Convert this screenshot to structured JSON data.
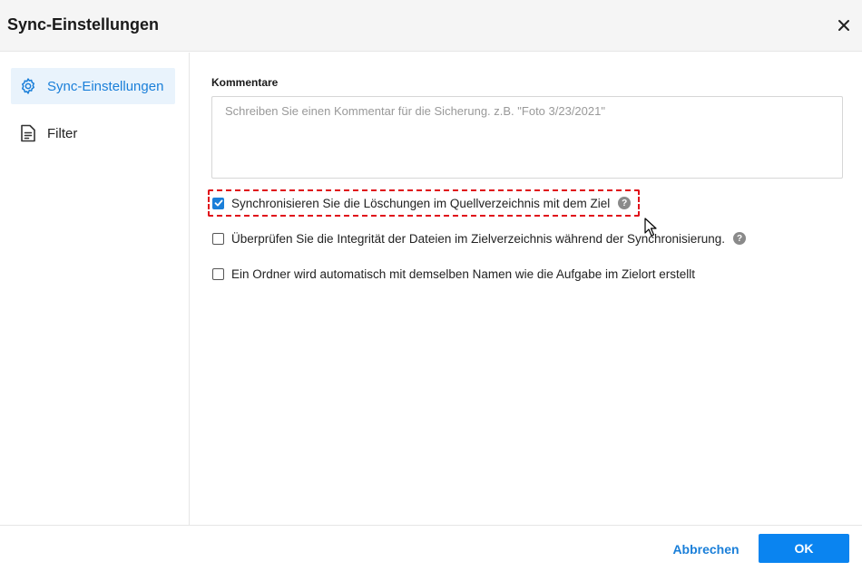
{
  "dialog": {
    "title": "Sync-Einstellungen",
    "close_icon": "close-icon"
  },
  "sidebar": {
    "items": [
      {
        "label": "Sync-Einstellungen",
        "icon": "gear-icon",
        "active": true
      },
      {
        "label": "Filter",
        "icon": "document-icon",
        "active": false
      }
    ]
  },
  "main": {
    "comments_label": "Kommentare",
    "comments_placeholder": "Schreiben Sie einen Kommentar für die Sicherung. z.B. \"Foto 3/23/2021\"",
    "comments_value": "",
    "options": [
      {
        "label": "Synchronisieren Sie die Löschungen im Quellverzeichnis mit dem Ziel",
        "checked": true,
        "help": true,
        "highlighted": true
      },
      {
        "label": "Überprüfen Sie die Integrität der Dateien im Zielverzeichnis während der Synchronisierung.",
        "checked": false,
        "help": true
      },
      {
        "label": "Ein Ordner wird automatisch mit demselben Namen wie die Aufgabe im Zielort erstellt",
        "checked": false,
        "help": false
      }
    ],
    "help_glyph": "?"
  },
  "footer": {
    "cancel_label": "Abbrechen",
    "ok_label": "OK"
  },
  "colors": {
    "accent": "#1a7fd9",
    "ok_button": "#0a84f0",
    "highlight": "#e0101a"
  }
}
